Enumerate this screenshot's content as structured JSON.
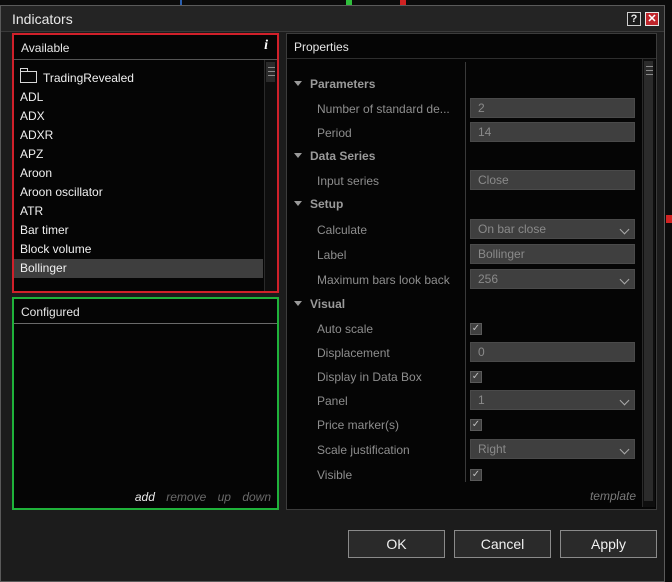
{
  "window": {
    "title": "Indicators",
    "help_label": "?",
    "close_label": "✕"
  },
  "available": {
    "header": "Available",
    "info_icon": "i",
    "folder": "TradingRevealed",
    "items": [
      "ADL",
      "ADX",
      "ADXR",
      "APZ",
      "Aroon",
      "Aroon oscillator",
      "ATR",
      "Bar timer",
      "Block volume",
      "Bollinger"
    ],
    "selected": "Bollinger"
  },
  "configured": {
    "header": "Configured",
    "actions": {
      "add": "add",
      "remove": "remove",
      "up": "up",
      "down": "down"
    }
  },
  "properties": {
    "header": "Properties",
    "template_link": "template",
    "categories": {
      "parameters": "Parameters",
      "data_series": "Data Series",
      "setup": "Setup",
      "visual": "Visual"
    },
    "rows": {
      "num_std_dev": {
        "label": "Number of standard de...",
        "value": "2"
      },
      "period": {
        "label": "Period",
        "value": "14"
      },
      "input_series": {
        "label": "Input series",
        "value": "Close"
      },
      "calculate": {
        "label": "Calculate",
        "value": "On bar close"
      },
      "label": {
        "label": "Label",
        "value": "Bollinger"
      },
      "max_bars": {
        "label": "Maximum bars look back",
        "value": "256"
      },
      "auto_scale": {
        "label": "Auto scale",
        "checked": true
      },
      "displacement": {
        "label": "Displacement",
        "value": "0"
      },
      "display_data_box": {
        "label": "Display in Data Box",
        "checked": true
      },
      "panel": {
        "label": "Panel",
        "value": "1"
      },
      "price_marker": {
        "label": "Price marker(s)",
        "checked": true
      },
      "scale_justification": {
        "label": "Scale justification",
        "value": "Right"
      },
      "visible": {
        "label": "Visible",
        "checked": true
      }
    }
  },
  "buttons": {
    "ok": "OK",
    "cancel": "Cancel",
    "apply": "Apply"
  },
  "colors": {
    "available_border": "#d0202a",
    "configured_border": "#1fb23a",
    "close_button": "#c0262c"
  }
}
